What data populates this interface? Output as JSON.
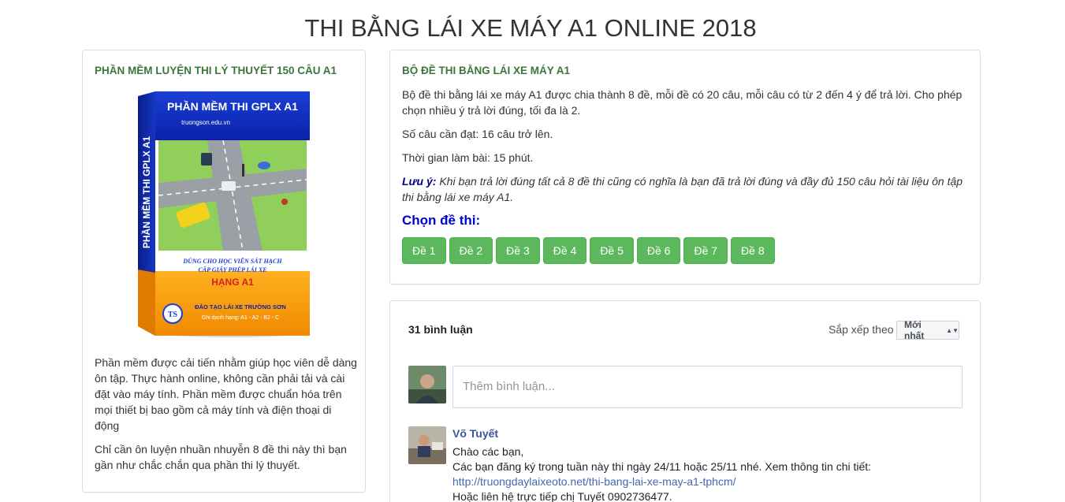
{
  "page": {
    "title": "THI BẰNG LÁI XE MÁY A1 ONLINE 2018"
  },
  "left_panel": {
    "title": "PHẦN MỀM LUYỆN THI LÝ THUYẾT 150 CÂU A1",
    "product": {
      "top_title": "PHẦN MỀM THI GPLX A1",
      "site": "truongson.edu.vn",
      "side_title": "PHẦN MỀM THI GPLX A1",
      "desc_line1": "DÙNG CHO HỌC VIÊN SÁT HẠCH",
      "desc_line2": "CẤP GIẤY PHÉP LÁI XE",
      "class": "HẠNG A1",
      "school": "ĐÀO TẠO LÁI XE TRƯỜNG SƠN",
      "classes": "Ghi danh hạng: A1 - A2 - B2 - C",
      "logo_text": "TS"
    },
    "paragraphs": [
      "Phần mềm được cải tiến nhằm giúp học viên dễ dàng ôn tập. Thực hành online, không cần phải tải và cài đặt vào máy tính. Phần mềm được chuẩn hóa trên mọi thiết bị bao gồm cả máy tính và điện thoại di động",
      "Chỉ cần ôn luyện nhuần nhuyễn 8 đề thi này thì bạn gần như chắc chắn qua phần thi lý thuyết."
    ]
  },
  "info_panel": {
    "title": "BỘ ĐỀ THI BẰNG LÁI XE MÁY A1",
    "p1": "Bộ đề thi bằng lái xe máy A1 được chia thành 8 đề, mỗi đề có 20 câu, mỗi câu có từ 2 đến 4 ý để trả lời. Cho phép chọn nhiều ý trả lời đúng, tối đa là 2.",
    "p2": "Số câu cần đạt: 16 câu trở lên.",
    "p3": "Thời gian làm bài: 15 phút.",
    "note_label": "Lưu ý:",
    "note_text": " Khi bạn trả lời đúng tất cả 8 đề thi cũng có nghĩa là bạn đã trả lời đúng và đầy đủ 150 câu hỏi tài liệu ôn tập thi bằng lái xe máy A1.",
    "choose_label": "Chọn đề thi:",
    "exams": [
      "Đề 1",
      "Đề 2",
      "Đề 3",
      "Đề 4",
      "Đề 5",
      "Đề 6",
      "Đề 7",
      "Đề 8"
    ]
  },
  "comments": {
    "count_label": "31 bình luận",
    "sort_label": "Sắp xếp theo",
    "sort_value": "Mới nhất",
    "input_placeholder": "Thêm bình luận...",
    "items": [
      {
        "author": "Võ Tuyết",
        "line1": "Chào các bạn,",
        "line2": "Các bạn đăng ký trong tuần này thi ngày 24/11 hoặc 25/11 nhé. Xem thông tin chi tiết:",
        "link": "http://truongdaylaixeoto.net/thi-bang-lai-xe-may-a1-tphcm/",
        "line3": "Hoặc liên hệ trực tiếp chị Tuyết 0902736477."
      }
    ]
  },
  "colors": {
    "accent_green": "#3c763d",
    "button_green": "#5cb85c",
    "choose_blue": "#0000cd",
    "fb_link": "#365899"
  }
}
